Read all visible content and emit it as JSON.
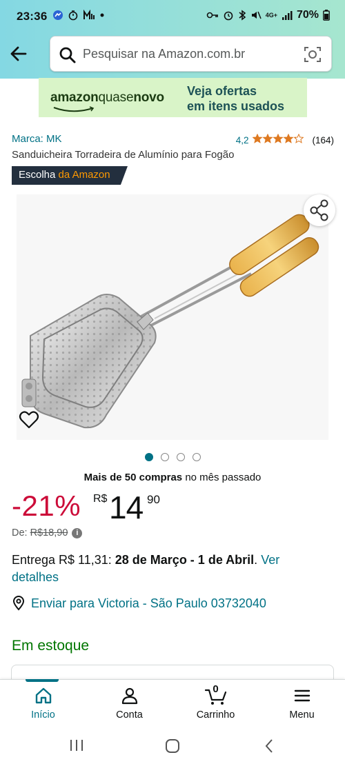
{
  "status_bar": {
    "time": "23:36",
    "network": "4G+",
    "battery": "70%"
  },
  "search": {
    "placeholder": "Pesquisar na Amazon.com.br"
  },
  "banner": {
    "brand_amazon": "amazon",
    "brand_quase": "quase",
    "brand_novo": "novo",
    "cta_line1": "Veja ofertas",
    "cta_line2": "em itens usados"
  },
  "product": {
    "brand_link": "Marca: MK",
    "rating_score": "4,2",
    "rating_value": 4.2,
    "rating_count": "(164)",
    "title": "Sanduicheira Torradeira de Alumínio para Fogão",
    "badge_part1": "Escolha",
    "badge_part2": "da Amazon",
    "image_count": 4,
    "image_selected": 1,
    "bought_bold": "Mais de 50 compras",
    "bought_rest": " no mês passado",
    "discount": "-21%",
    "currency": "R$",
    "price_whole": "14",
    "price_cents": "90",
    "list_label": "De:",
    "list_price": "R$18,90",
    "delivery_prefix": "Entrega R$ 11,31: ",
    "delivery_dates": "28 de Março - 1 de Abril",
    "delivery_link": "Ver detalhes",
    "ship_to": "Enviar para Victoria - São Paulo 03732040",
    "stock": "Em estoque"
  },
  "bottom_nav": {
    "items": [
      {
        "label": "Início",
        "icon": "home-icon",
        "active": true
      },
      {
        "label": "Conta",
        "icon": "person-icon",
        "active": false
      },
      {
        "label": "Carrinho",
        "icon": "cart-icon",
        "active": false,
        "badge": "0"
      },
      {
        "label": "Menu",
        "icon": "menu-icon",
        "active": false
      }
    ]
  },
  "colors": {
    "accent": "#007185",
    "discount": "#cc0c39",
    "stock": "#007600",
    "star": "#de7921",
    "badge_bg": "#232f3e",
    "badge_highlight": "#ff9900"
  }
}
